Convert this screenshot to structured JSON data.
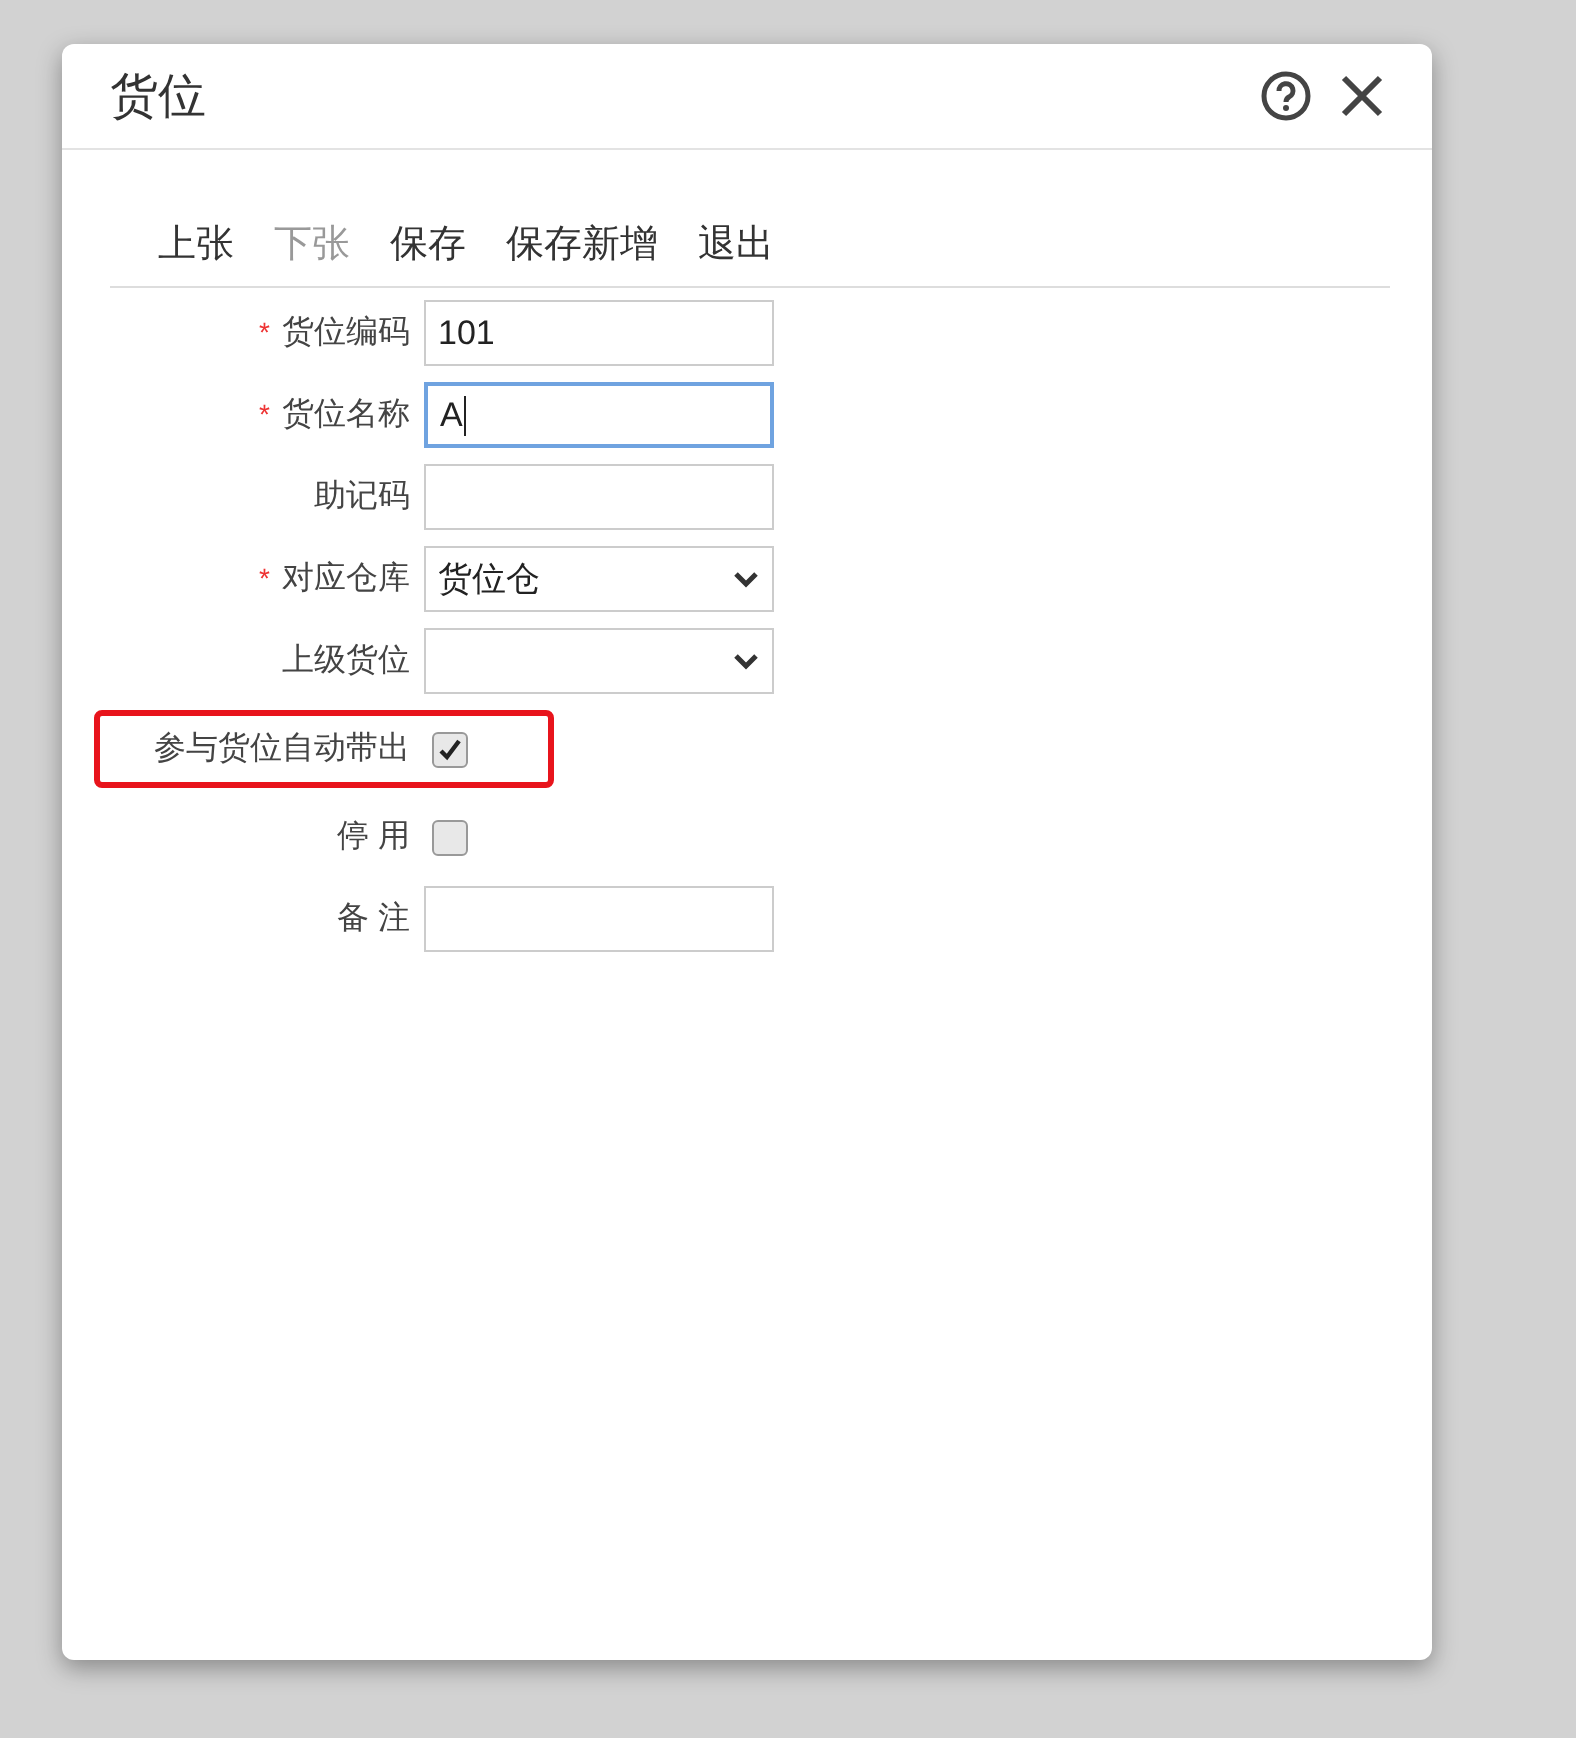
{
  "window": {
    "title": "货位"
  },
  "toolbar": [
    {
      "label": "上张",
      "disabled": false
    },
    {
      "label": "下张",
      "disabled": true
    },
    {
      "label": "保存",
      "disabled": false
    },
    {
      "label": "保存新增",
      "disabled": false
    },
    {
      "label": "退出",
      "disabled": false
    }
  ],
  "fields": [
    {
      "kind": "text",
      "required_mark": "*",
      "label": "货位编码",
      "value": "101",
      "focused": false,
      "highlighted": false
    },
    {
      "kind": "text",
      "required_mark": "*",
      "label": "货位名称",
      "value": "A",
      "focused": true,
      "highlighted": false
    },
    {
      "kind": "text",
      "label": "助记码",
      "focused": false,
      "highlighted": false
    },
    {
      "kind": "select",
      "required_mark": "*",
      "label": "对应仓库",
      "value": "货位仓",
      "highlighted": false
    },
    {
      "kind": "select",
      "label": "上级货位",
      "highlighted": false
    },
    {
      "kind": "checkbox",
      "label": "参与货位自动带出",
      "checked": true,
      "highlighted": true
    },
    {
      "kind": "checkbox",
      "label": "停 用",
      "checked": false,
      "highlighted": false
    },
    {
      "kind": "text",
      "label": "备 注",
      "focused": false,
      "highlighted": false
    }
  ]
}
